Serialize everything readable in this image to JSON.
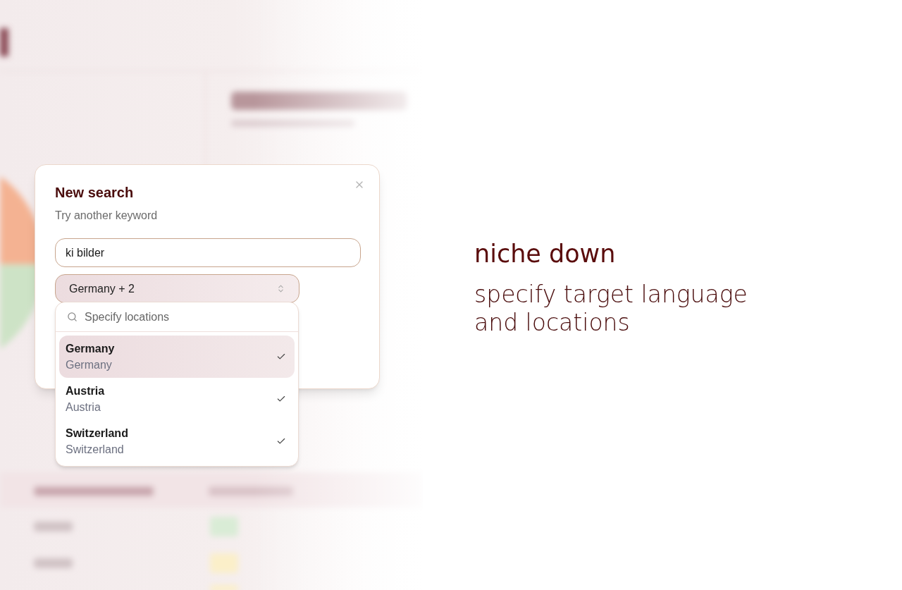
{
  "dialog": {
    "title": "New search",
    "subtitle": "Try another keyword",
    "keyword_field": {
      "value": "ki bilder"
    },
    "location_select": {
      "value": "Germany + 2",
      "expanded": true
    }
  },
  "location_menu": {
    "search": {
      "placeholder": "Specify locations"
    },
    "options": [
      {
        "name": "Germany",
        "detail": "Germany",
        "checked": true,
        "selected": true
      },
      {
        "name": "Austria",
        "detail": "Austria",
        "checked": true,
        "selected": false
      },
      {
        "name": "Switzerland",
        "detail": "Switzerland",
        "checked": true,
        "selected": false
      }
    ]
  },
  "caption": {
    "title": "niche down",
    "body": "specify target language and locations"
  }
}
